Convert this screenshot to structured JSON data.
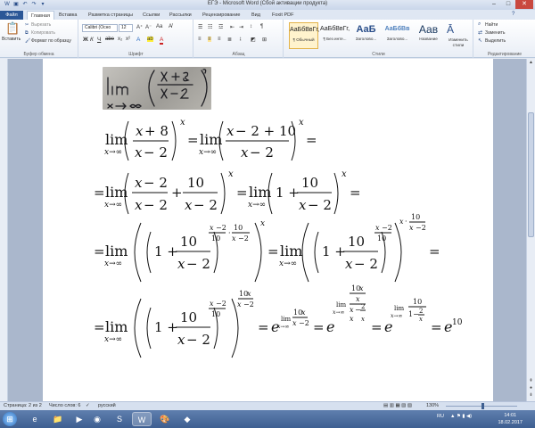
{
  "window": {
    "title": "ЕГЭ - Microsoft Word (Сбой активации продукта)"
  },
  "tabs": [
    {
      "label": "Файл"
    },
    {
      "label": "Главная"
    },
    {
      "label": "Вставка"
    },
    {
      "label": "Разметка страницы"
    },
    {
      "label": "Ссылки"
    },
    {
      "label": "Рассылки"
    },
    {
      "label": "Рецензирование"
    },
    {
      "label": "Вид"
    },
    {
      "label": "Foxit PDF"
    }
  ],
  "ribbon": {
    "clipboard": {
      "paste": "Вставить",
      "cut": "Вырезать",
      "copy": "Копировать",
      "format_painter": "Формат по образцу",
      "group": "Буфер обмена"
    },
    "font": {
      "family": "Calibri (Осно",
      "size": "12",
      "group": "Шрифт"
    },
    "paragraph": {
      "group": "Абзац"
    },
    "styles": {
      "items": [
        {
          "preview": "АаБбВвГг,",
          "label": "¶ Обычный"
        },
        {
          "preview": "АаБбВвГг,",
          "label": "¶ Без инте..."
        },
        {
          "preview": "АаБ",
          "label": "Заголово..."
        },
        {
          "preview": "АаБбВв",
          "label": "Заголово..."
        },
        {
          "preview": "Аав",
          "label": "Название"
        }
      ],
      "change": "Изменить стили",
      "group": "Стили"
    },
    "editing": {
      "find": "Найти",
      "replace": "Заменить",
      "select": "Выделить",
      "group": "Редактирование"
    }
  },
  "status": {
    "page": "Страница: 2 из 2",
    "words": "Число слов: 6",
    "language": "русский",
    "zoom": "130%"
  },
  "taskbar": {
    "lang": "RU",
    "time": "14:01",
    "date": "18.02.2017"
  }
}
